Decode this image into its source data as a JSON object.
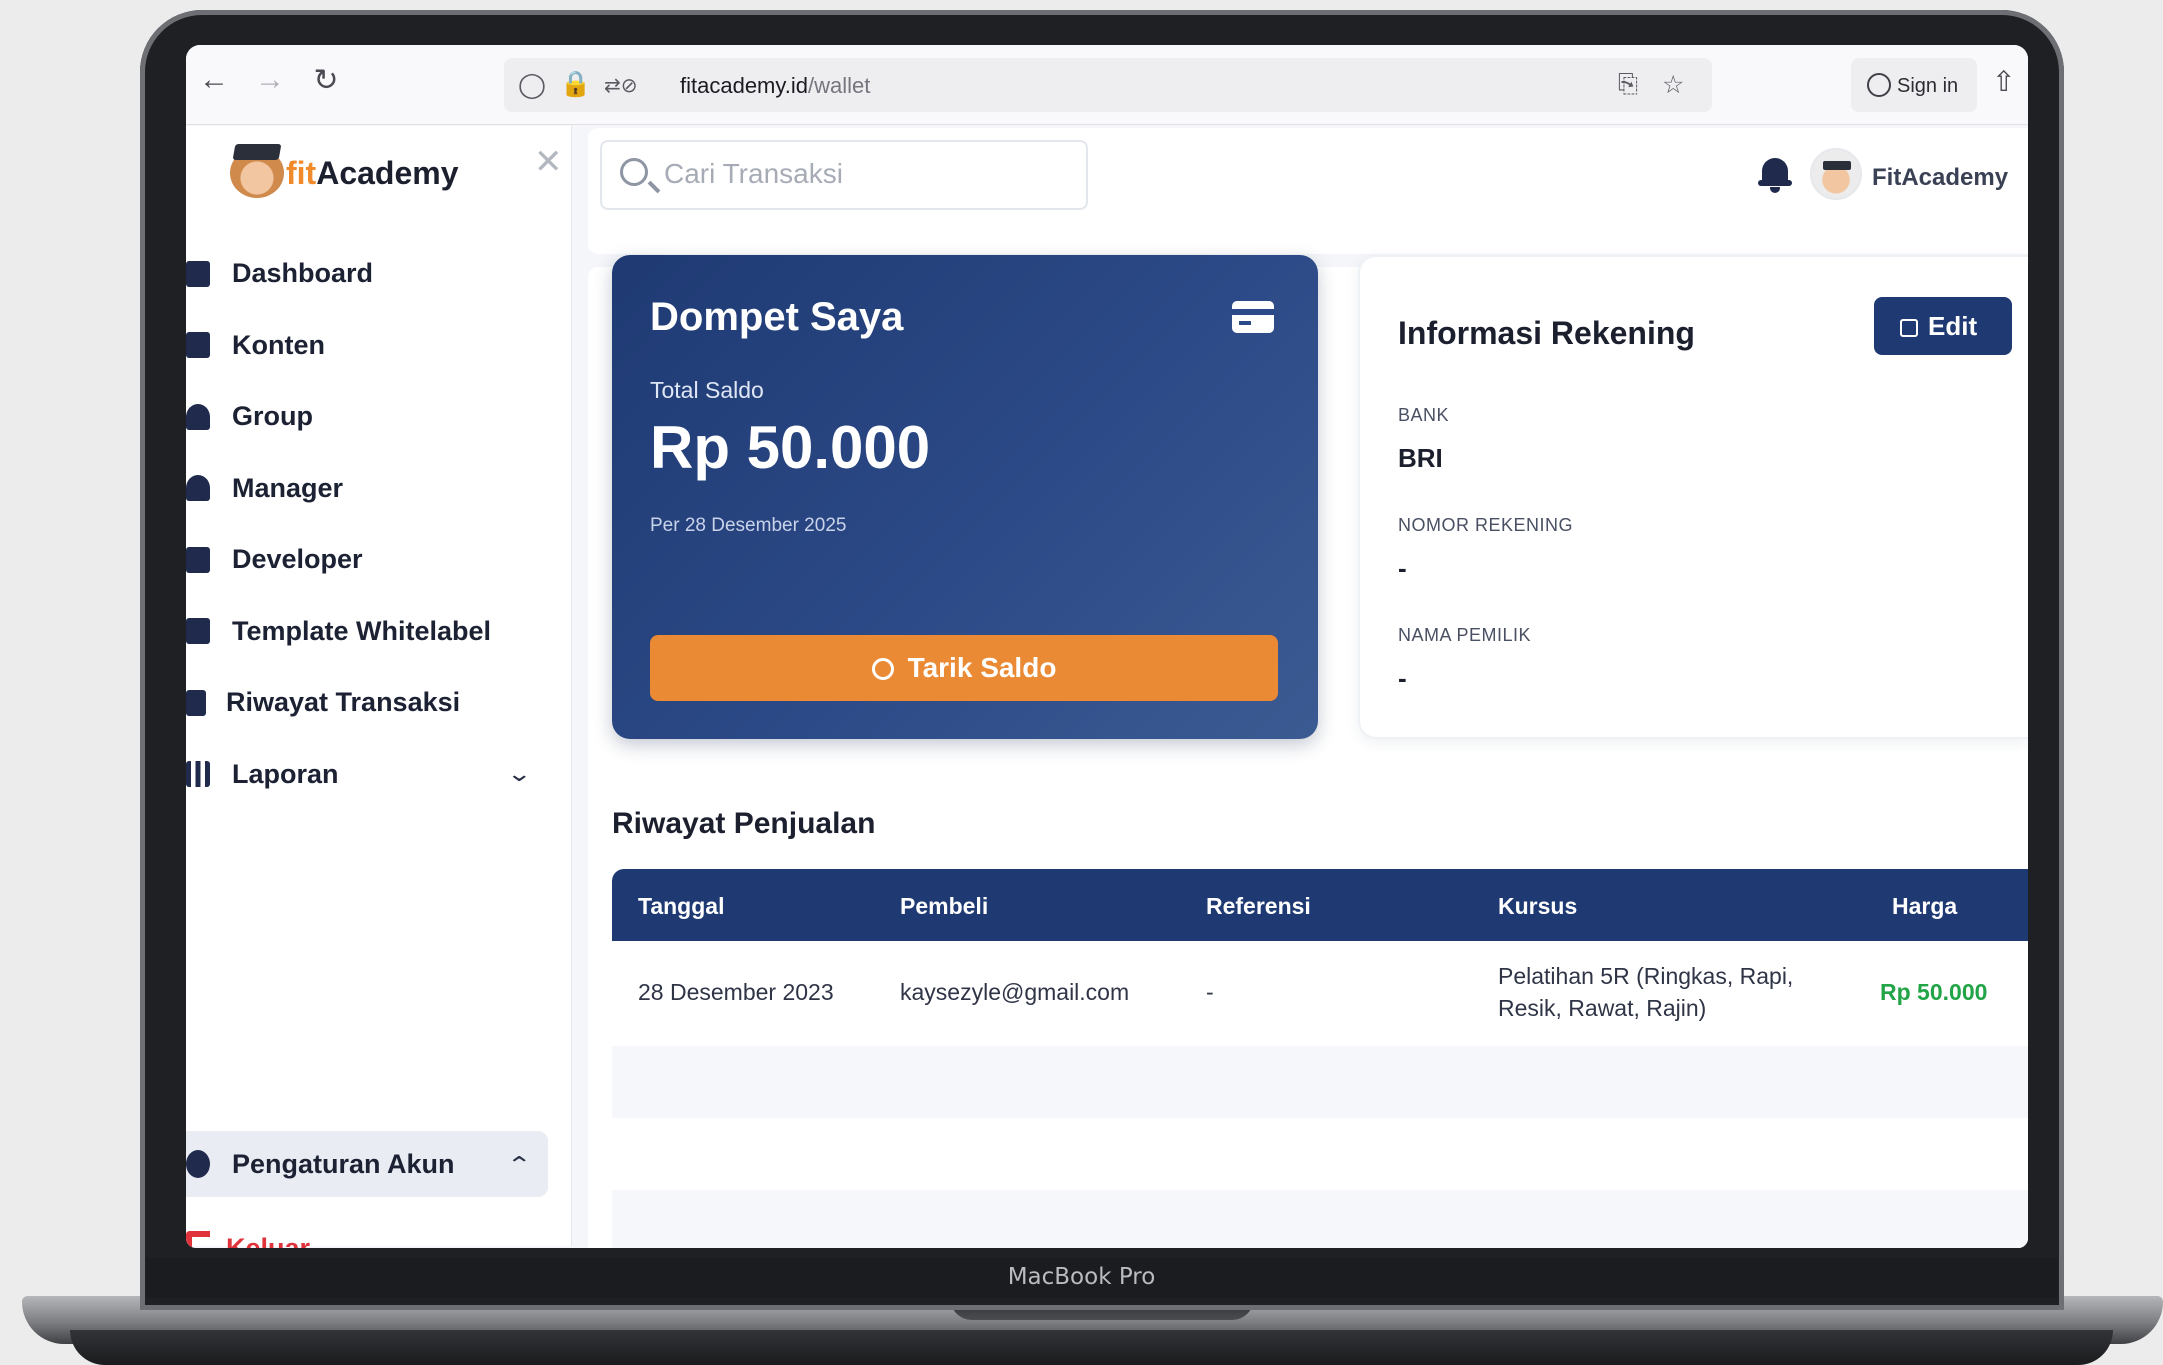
{
  "device_label": "MacBook Pro",
  "browser": {
    "url_domain": "fitacademy.id",
    "url_path": "/wallet",
    "sign_in": "Sign in"
  },
  "sidebar": {
    "logo_prefix": "fit",
    "logo_suffix": "Academy",
    "items": [
      {
        "label": "Dashboard",
        "icon": "dashboard-icon"
      },
      {
        "label": "Konten",
        "icon": "content-icon"
      },
      {
        "label": "Group",
        "icon": "group-icon"
      },
      {
        "label": "Manager",
        "icon": "manager-icon"
      },
      {
        "label": "Developer",
        "icon": "developer-icon"
      },
      {
        "label": "Template Whitelabel",
        "icon": "template-icon"
      },
      {
        "label": "Riwayat Transaksi",
        "icon": "history-icon"
      },
      {
        "label": "Laporan",
        "icon": "report-icon"
      }
    ],
    "settings_label": "Pengaturan Akun",
    "logout_label": "Keluar"
  },
  "header": {
    "search_placeholder": "Cari Transaksi",
    "username": "FitAcademy"
  },
  "wallet": {
    "title": "Dompet Saya",
    "balance_label": "Total Saldo",
    "balance": "Rp 50.000",
    "as_of": "Per 28 Desember 2025",
    "withdraw_label": "Tarik Saldo"
  },
  "account_info": {
    "title": "Informasi Rekening",
    "edit_label": "Edit",
    "bank_label": "BANK",
    "bank_value": "BRI",
    "number_label": "NOMOR REKENING",
    "number_value": "-",
    "owner_label": "NAMA PEMILIK",
    "owner_value": "-"
  },
  "sales": {
    "title": "Riwayat Penjualan",
    "columns": [
      "Tanggal",
      "Pembeli",
      "Referensi",
      "Kursus",
      "Harga"
    ],
    "rows": [
      {
        "date": "28 Desember 2023",
        "buyer": "kaysezyle@gmail.com",
        "reference": "-",
        "course_line1": "Pelatihan 5R (Ringkas, Rapi,",
        "course_line2": "Resik, Rawat, Rajin)",
        "price": "Rp 50.000"
      }
    ]
  },
  "colors": {
    "primary": "#1f3a73",
    "accent": "#ea8a34",
    "danger": "#e0323a",
    "success": "#22a447"
  }
}
